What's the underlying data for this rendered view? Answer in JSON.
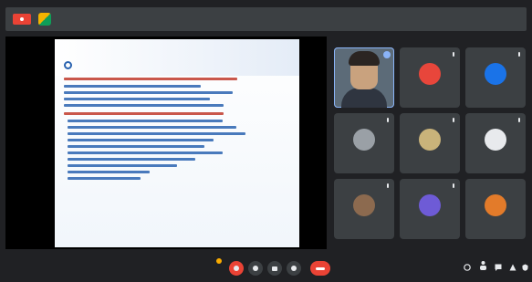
{
  "recording_badge": "",
  "meeting_title": "",
  "slide": {
    "title": "",
    "line_color_primary": "#c0392b",
    "line_color_secondary": "#2a63b0"
  },
  "participants": [
    {
      "name": "",
      "kind": "camera",
      "selected": true,
      "color": "#5c6b78"
    },
    {
      "name": "",
      "kind": "logo",
      "selected": false,
      "color": "#e8463b"
    },
    {
      "name": "",
      "kind": "logo",
      "selected": false,
      "color": "#1a73e8"
    },
    {
      "name": "",
      "kind": "logo",
      "selected": false,
      "color": "#9aa0a6"
    },
    {
      "name": "",
      "kind": "logo",
      "selected": false,
      "color": "#c9b37a"
    },
    {
      "name": "",
      "kind": "logo",
      "selected": false,
      "color": "#e8eaed"
    },
    {
      "name": "",
      "kind": "logo",
      "selected": false,
      "color": "#8c6a4f"
    },
    {
      "name": "",
      "kind": "logo",
      "selected": false,
      "color": "#6e5bd6"
    },
    {
      "name": "",
      "kind": "logo",
      "selected": false,
      "color": "#e37b2a"
    }
  ],
  "bottom": {
    "clock_and_meeting": ""
  },
  "colors": {
    "accent_red": "#ea4335",
    "panel": "#3c4043",
    "background": "#202124"
  }
}
